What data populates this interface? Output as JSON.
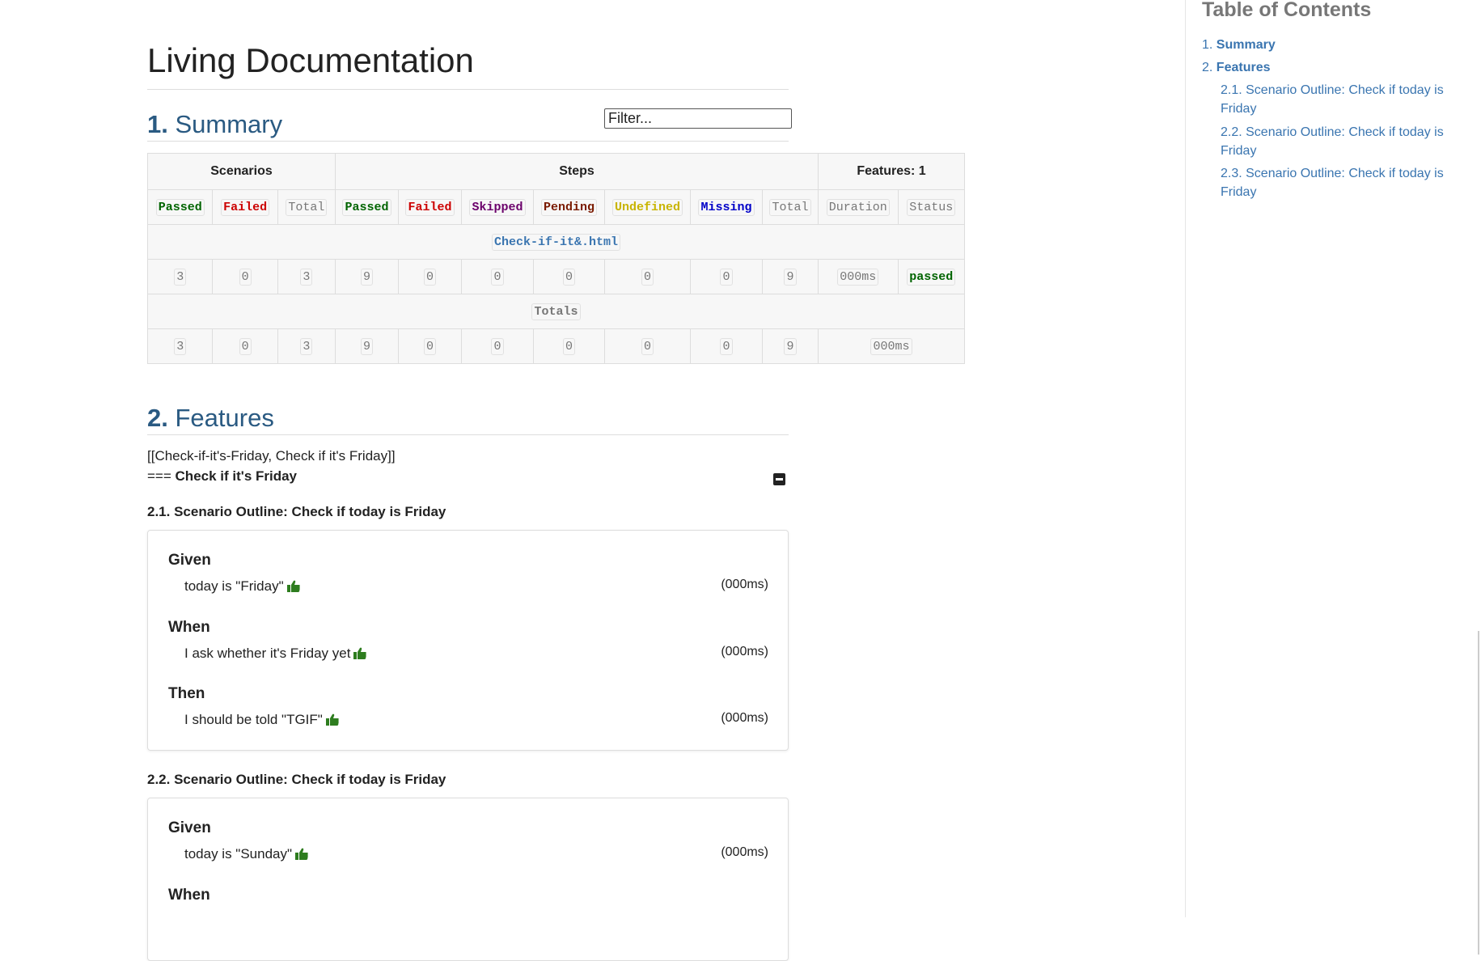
{
  "doc": {
    "title": "Living Documentation"
  },
  "summary": {
    "num": "1.",
    "title": "Summary",
    "filter_placeholder": "Filter...",
    "groups": {
      "scenarios": "Scenarios",
      "steps": "Steps",
      "features": "Features: 1"
    },
    "columns": [
      "Passed",
      "Failed",
      "Total",
      "Passed",
      "Failed",
      "Skipped",
      "Pending",
      "Undefined",
      "Missing",
      "Total",
      "Duration",
      "Status"
    ],
    "feature_link": "Check-if-it&.html",
    "feature_row": [
      "3",
      "0",
      "3",
      "9",
      "0",
      "0",
      "0",
      "0",
      "0",
      "9",
      "000ms",
      "passed"
    ],
    "totals_label": "Totals",
    "totals_row": [
      "3",
      "0",
      "3",
      "9",
      "0",
      "0",
      "0",
      "0",
      "0",
      "9",
      "000ms"
    ]
  },
  "features": {
    "num": "2.",
    "title": "Features",
    "xref_text": "[[Check-if-it's-Friday, Check if it's Friday]]",
    "feature_prefix": "===",
    "feature_name": "Check if it's Friday",
    "scenarios": [
      {
        "title": "2.1. Scenario Outline: Check if today is Friday",
        "steps": [
          {
            "keyword": "Given",
            "text": "today is \"Friday\"",
            "duration": "(000ms)"
          },
          {
            "keyword": "When",
            "text": "I ask whether it's Friday yet",
            "duration": "(000ms)"
          },
          {
            "keyword": "Then",
            "text": "I should be told \"TGIF\"",
            "duration": "(000ms)"
          }
        ]
      },
      {
        "title": "2.2. Scenario Outline: Check if today is Friday",
        "steps": [
          {
            "keyword": "Given",
            "text": "today is \"Sunday\"",
            "duration": "(000ms)"
          },
          {
            "keyword": "When",
            "text": "",
            "duration": ""
          }
        ]
      }
    ]
  },
  "toc": {
    "title": "Table of Contents",
    "items": [
      {
        "num": "1.",
        "label": "Summary"
      },
      {
        "num": "2.",
        "label": "Features"
      }
    ],
    "subitems": [
      {
        "line1": "2.1. Scenario Outline: Check if today is",
        "line2": "Friday"
      },
      {
        "line1": "2.2. Scenario Outline: Check if today is",
        "line2": "Friday"
      },
      {
        "line1": "2.3. Scenario Outline: Check if today is",
        "line2": "Friday"
      }
    ]
  },
  "colors": {
    "passed": "#006400",
    "failed": "#cc0000",
    "skipped": "#6b006b",
    "pending": "#7a1a00",
    "undefined": "#c8b400",
    "missing": "#0000c8",
    "link": "#3a75b0",
    "heading": "#2a5a82"
  }
}
